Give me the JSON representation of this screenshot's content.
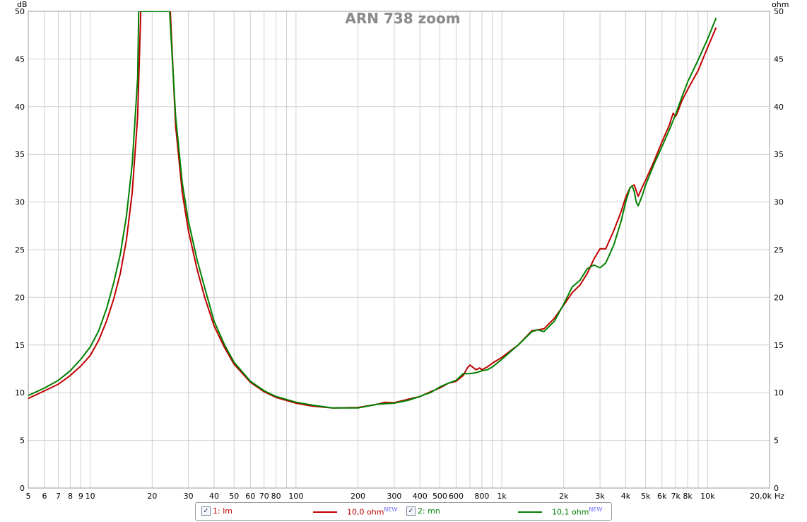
{
  "chart_data": {
    "type": "line",
    "title": "ARN 738 zoom",
    "y_unit_left": "dB",
    "y_unit_right": "ohm",
    "x_unit": "Hz",
    "x_scale": "log",
    "xlim": [
      5,
      20000
    ],
    "ylim": [
      0,
      50
    ],
    "grid": true,
    "legend_position": "bottom",
    "x_tick_labels": [
      {
        "v": 5,
        "t": "5"
      },
      {
        "v": 6,
        "t": "6"
      },
      {
        "v": 7,
        "t": "7"
      },
      {
        "v": 8,
        "t": "8"
      },
      {
        "v": 9,
        "t": "9"
      },
      {
        "v": 10,
        "t": "10"
      },
      {
        "v": 20,
        "t": "20"
      },
      {
        "v": 30,
        "t": "30"
      },
      {
        "v": 40,
        "t": "40"
      },
      {
        "v": 50,
        "t": "50"
      },
      {
        "v": 60,
        "t": "60"
      },
      {
        "v": 70,
        "t": "70"
      },
      {
        "v": 80,
        "t": "80"
      },
      {
        "v": 100,
        "t": "100"
      },
      {
        "v": 200,
        "t": "200"
      },
      {
        "v": 300,
        "t": "300"
      },
      {
        "v": 400,
        "t": "400"
      },
      {
        "v": 500,
        "t": "500"
      },
      {
        "v": 600,
        "t": "600"
      },
      {
        "v": 800,
        "t": "800"
      },
      {
        "v": 1000,
        "t": "1k"
      },
      {
        "v": 2000,
        "t": "2k"
      },
      {
        "v": 3000,
        "t": "3k"
      },
      {
        "v": 4000,
        "t": "4k"
      },
      {
        "v": 5000,
        "t": "5k"
      },
      {
        "v": 6000,
        "t": "6k"
      },
      {
        "v": 7000,
        "t": "7k"
      },
      {
        "v": 8000,
        "t": "8k"
      },
      {
        "v": 10000,
        "t": "10k"
      },
      {
        "v": 20000,
        "t": "20,0k"
      }
    ],
    "y_tick_labels": [
      "0",
      "5",
      "10",
      "15",
      "20",
      "25",
      "30",
      "35",
      "40",
      "45",
      "50"
    ],
    "series": [
      {
        "name": "1: lm",
        "legend_value": "10,0 ohm",
        "color": "#c00000",
        "x": [
          5,
          6,
          7,
          8,
          9,
          10,
          11,
          12,
          13,
          14,
          15,
          16,
          17,
          17.6,
          24.5,
          26,
          28,
          30,
          33,
          36,
          40,
          45,
          50,
          60,
          70,
          80,
          100,
          120,
          150,
          200,
          250,
          270,
          300,
          350,
          400,
          450,
          500,
          550,
          600,
          650,
          680,
          700,
          720,
          750,
          780,
          800,
          850,
          900,
          1000,
          1200,
          1400,
          1600,
          1800,
          2000,
          2200,
          2400,
          2600,
          2800,
          3000,
          3200,
          3500,
          3800,
          4000,
          4200,
          4400,
          4600,
          4800,
          5000,
          5500,
          6000,
          6500,
          6800,
          7000,
          7200,
          7500,
          8000,
          9000,
          10000,
          11000
        ],
        "y": [
          9.4,
          10.2,
          10.9,
          11.8,
          12.8,
          13.9,
          15.5,
          17.5,
          19.8,
          22.5,
          26,
          31,
          39,
          50,
          50,
          38,
          31,
          27,
          23,
          20,
          17,
          14.7,
          13,
          11.1,
          10.1,
          9.5,
          8.9,
          8.6,
          8.4,
          8.45,
          8.8,
          9,
          8.95,
          9.3,
          9.6,
          10.1,
          10.5,
          11,
          11.2,
          11.8,
          12.6,
          12.9,
          12.7,
          12.4,
          12.6,
          12.4,
          12.7,
          13.1,
          13.7,
          15,
          16.5,
          16.7,
          17.8,
          19.2,
          20.5,
          21.3,
          22.5,
          24,
          25.1,
          25.1,
          27,
          29,
          30.5,
          31.5,
          31.8,
          30.6,
          31.5,
          32.3,
          34.3,
          36.3,
          38,
          39.3,
          39,
          39.6,
          40.6,
          41.8,
          43.8,
          46.2,
          48.3
        ]
      },
      {
        "name": "2: mn",
        "legend_value": "10,1 ohm",
        "color": "#008000",
        "x": [
          5,
          6,
          7,
          8,
          9,
          10,
          11,
          12,
          13,
          14,
          15,
          16,
          17,
          17.2,
          24.3,
          26,
          28,
          30,
          33,
          36,
          40,
          45,
          50,
          60,
          70,
          80,
          100,
          120,
          150,
          200,
          250,
          300,
          350,
          400,
          420,
          450,
          500,
          550,
          600,
          650,
          700,
          750,
          800,
          850,
          900,
          1000,
          1200,
          1400,
          1500,
          1600,
          1800,
          2000,
          2200,
          2400,
          2600,
          2800,
          3000,
          3200,
          3500,
          3800,
          4000,
          4200,
          4300,
          4400,
          4500,
          4600,
          4800,
          5000,
          5500,
          6000,
          6500,
          7000,
          7500,
          8000,
          9000,
          10000,
          11000
        ],
        "y": [
          9.7,
          10.5,
          11.3,
          12.3,
          13.5,
          14.8,
          16.5,
          18.8,
          21.5,
          24.5,
          28.5,
          34,
          43,
          50,
          50,
          39,
          32,
          28,
          24,
          21,
          17.5,
          15,
          13.2,
          11.2,
          10.2,
          9.6,
          9,
          8.7,
          8.4,
          8.4,
          8.8,
          8.9,
          9.2,
          9.6,
          9.8,
          10,
          10.6,
          11,
          11.3,
          12,
          12,
          12.1,
          12.3,
          12.4,
          12.7,
          13.5,
          15,
          16.4,
          16.6,
          16.4,
          17.5,
          19.3,
          21.1,
          21.8,
          23,
          23.4,
          23.1,
          23.6,
          25.5,
          28,
          30,
          31.5,
          31.7,
          31.1,
          30,
          29.6,
          30.6,
          31.8,
          34,
          35.8,
          37.5,
          39.2,
          41,
          42.6,
          44.9,
          47.1,
          49.3
        ]
      }
    ]
  },
  "legend": {
    "items": [
      {
        "checked": "✓",
        "label": "1: lm",
        "value": "10,0 ohm",
        "badge": "NEW",
        "color": "#c00000"
      },
      {
        "checked": "✓",
        "label": "2: mn",
        "value": "10,1 ohm",
        "badge": "NEW",
        "color": "#008000"
      }
    ]
  }
}
